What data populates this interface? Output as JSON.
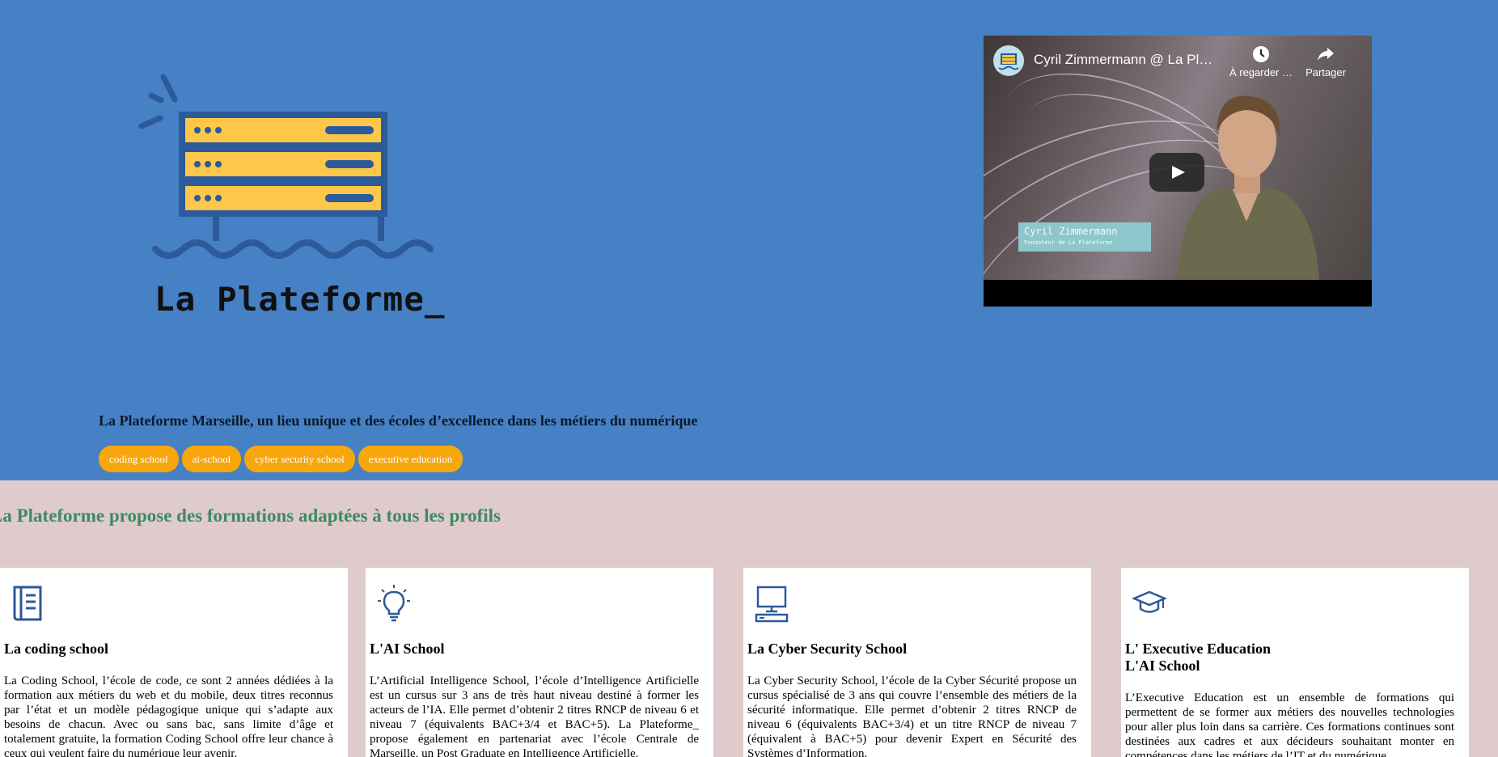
{
  "logo": {
    "text": "La Plateforme_"
  },
  "video": {
    "title": "Cyril Zimmermann @ La Pl…",
    "watch_later_label": "À regarder …",
    "share_label": "Partager",
    "name_tag": "Cyril Zimmermann",
    "name_tag_subtitle": "Fondateur de La Plateforme"
  },
  "hero": {
    "tagline": "La Plateforme Marseille, un lieu unique et des écoles d’excellence dans les métiers du numérique",
    "chips": [
      "coding school",
      "ai-school",
      "cyber security school",
      "executive education"
    ]
  },
  "formations": {
    "title": "La Plateforme propose des formations adaptées à tous les profils",
    "cards": [
      {
        "icon": "book-icon",
        "title": "La coding school",
        "text": "La Coding School, l’école de code, ce sont 2 années dédiées à la formation aux métiers du web et du mobile, deux titres reconnus par l’état et un modèle pédagogique unique qui s’adapte aux besoins de chacun. Avec ou sans bac, sans limite d’âge et totalement gratuite, la formation Coding School offre leur chance à ceux qui veulent faire du numérique leur avenir."
      },
      {
        "icon": "lightbulb-icon",
        "title": "L'AI School",
        "text": "L’Artificial Intelligence School, l’école d’Intelligence Artificielle est un cursus sur 3 ans de très haut niveau destiné à former les acteurs de l’IA. Elle permet d’obtenir 2 titres RNCP de niveau 6 et niveau 7 (équivalents BAC+3/4 et BAC+5). La Plateforme_ propose également en partenariat avec l’école Centrale de Marseille, un Post Graduate en Intelligence Artificielle."
      },
      {
        "icon": "computer-icon",
        "title": "La Cyber Security School",
        "text": "La Cyber Security School, l’école de la Cyber Sécurité propose un cursus spécialisé de 3 ans qui couvre l’ensemble des métiers de la sécurité informatique. Elle permet d’obtenir 2 titres RNCP de niveau 6 (équivalents BAC+3/4) et un titre RNCP de niveau 7 (équivalent à BAC+5) pour devenir Expert en Sécurité des Systèmes d’Information."
      },
      {
        "icon": "graduation-cap-icon",
        "title": "L' Executive Education",
        "subtitle": "L'AI School",
        "text": "L’Executive Education est un ensemble de formations qui permettent de se former aux métiers des nouvelles technologies pour aller plus loin dans sa carrière. Ces formations continues sont destinées aux cadres et aux décideurs souhaitant monter en compétences dans les métiers de l’IT et du numérique."
      }
    ]
  },
  "colors": {
    "hero_bg": "#4680c5",
    "section_bg": "#dfcbcb",
    "chip": "#f7a70c",
    "logo_yellow": "#fdc84a",
    "logo_blue": "#2c5a9a",
    "section_title": "#3d8a65"
  }
}
